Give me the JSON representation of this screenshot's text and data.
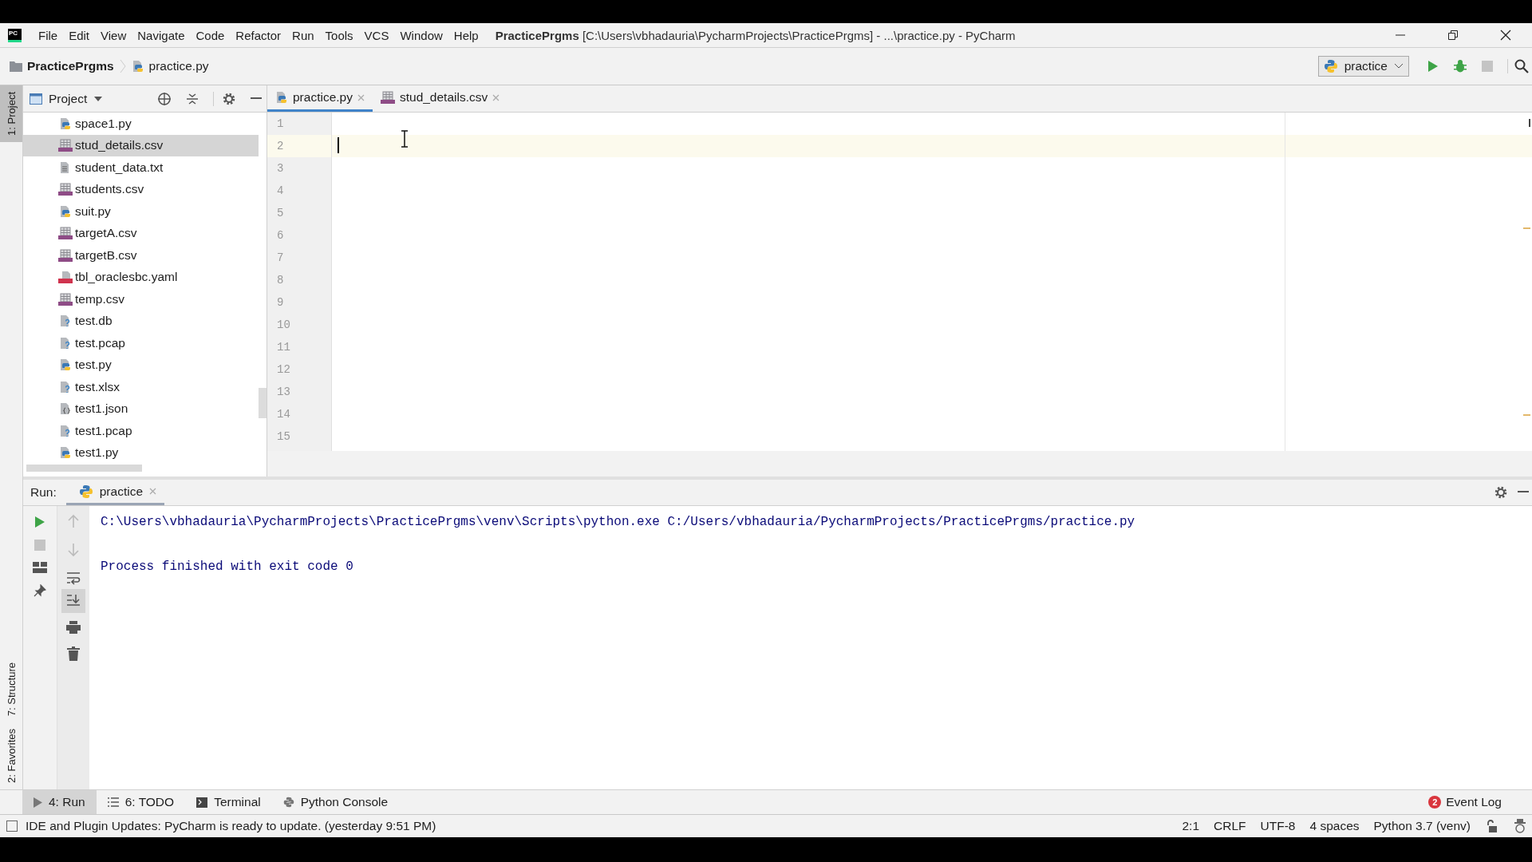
{
  "window": {
    "app_icon": "PC",
    "menu": [
      "File",
      "Edit",
      "View",
      "Navigate",
      "Code",
      "Refactor",
      "Run",
      "Tools",
      "VCS",
      "Window",
      "Help"
    ],
    "project": "PracticePrgms",
    "title": "[C:\\Users\\vbhadauria\\PycharmProjects\\PracticePrgms] - ...\\practice.py - PyCharm"
  },
  "breadcrumb": [
    {
      "label": "PracticePrgms",
      "kind": "folder"
    },
    {
      "label": "practice.py",
      "kind": "py"
    }
  ],
  "run_config": "practice",
  "side_tabs": [
    {
      "label": "1: Project",
      "selected": true
    },
    {
      "label": "7: Structure",
      "selected": false
    },
    {
      "label": "2: Favorites",
      "selected": false
    }
  ],
  "project_panel": {
    "title": "Project",
    "files": [
      {
        "name": "space1.py",
        "kind": "py",
        "selected": false
      },
      {
        "name": "stud_details.csv",
        "kind": "csv",
        "selected": true
      },
      {
        "name": "student_data.txt",
        "kind": "txt",
        "selected": false
      },
      {
        "name": "students.csv",
        "kind": "csv",
        "selected": false
      },
      {
        "name": "suit.py",
        "kind": "py",
        "selected": false
      },
      {
        "name": "targetA.csv",
        "kind": "csv",
        "selected": false
      },
      {
        "name": "targetB.csv",
        "kind": "csv",
        "selected": false
      },
      {
        "name": "tbl_oraclesbc.yaml",
        "kind": "yaml",
        "selected": false
      },
      {
        "name": "temp.csv",
        "kind": "csv",
        "selected": false
      },
      {
        "name": "test.db",
        "kind": "unknown",
        "selected": false
      },
      {
        "name": "test.pcap",
        "kind": "unknown",
        "selected": false
      },
      {
        "name": "test.py",
        "kind": "py",
        "selected": false
      },
      {
        "name": "test.xlsx",
        "kind": "unknown",
        "selected": false
      },
      {
        "name": "test1.json",
        "kind": "json",
        "selected": false
      },
      {
        "name": "test1.pcap",
        "kind": "unknown",
        "selected": false
      },
      {
        "name": "test1.py",
        "kind": "py",
        "selected": false
      }
    ]
  },
  "editor_tabs": [
    {
      "label": "practice.py",
      "kind": "py",
      "selected": true
    },
    {
      "label": "stud_details.csv",
      "kind": "csv",
      "selected": false
    }
  ],
  "editor": {
    "lines": [
      {
        "number": "1",
        "current": false
      },
      {
        "number": "2",
        "current": true
      },
      {
        "number": "3",
        "current": false
      },
      {
        "number": "4",
        "current": false
      },
      {
        "number": "5",
        "current": false
      },
      {
        "number": "6",
        "current": false
      },
      {
        "number": "7",
        "current": false
      },
      {
        "number": "8",
        "current": false
      },
      {
        "number": "9",
        "current": false
      },
      {
        "number": "10",
        "current": false
      },
      {
        "number": "11",
        "current": false
      },
      {
        "number": "12",
        "current": false
      },
      {
        "number": "13",
        "current": false
      },
      {
        "number": "14",
        "current": false
      },
      {
        "number": "15",
        "current": false
      }
    ]
  },
  "run_panel": {
    "label": "Run:",
    "tab": "practice",
    "output": [
      "C:\\Users\\vbhadauria\\PycharmProjects\\PracticePrgms\\venv\\Scripts\\python.exe C:/Users/vbhadauria/PycharmProjects/PracticePrgms/practice.py",
      "Process finished with exit code 0"
    ]
  },
  "tool_tabs": [
    {
      "label": "4: Run",
      "kind": "run",
      "selected": true
    },
    {
      "label": "6: TODO",
      "kind": "todo",
      "selected": false
    },
    {
      "label": "Terminal",
      "kind": "terminal",
      "selected": false
    },
    {
      "label": "Python Console",
      "kind": "console",
      "selected": false
    }
  ],
  "event_log": {
    "count": "2",
    "label": "Event Log"
  },
  "status_bar": {
    "message": "IDE and Plugin Updates: PyCharm is ready to update. (yesterday 9:51 PM)",
    "items": [
      "2:1",
      "CRLF",
      "UTF-8",
      "4 spaces",
      "Python 3.7 (venv)"
    ]
  }
}
